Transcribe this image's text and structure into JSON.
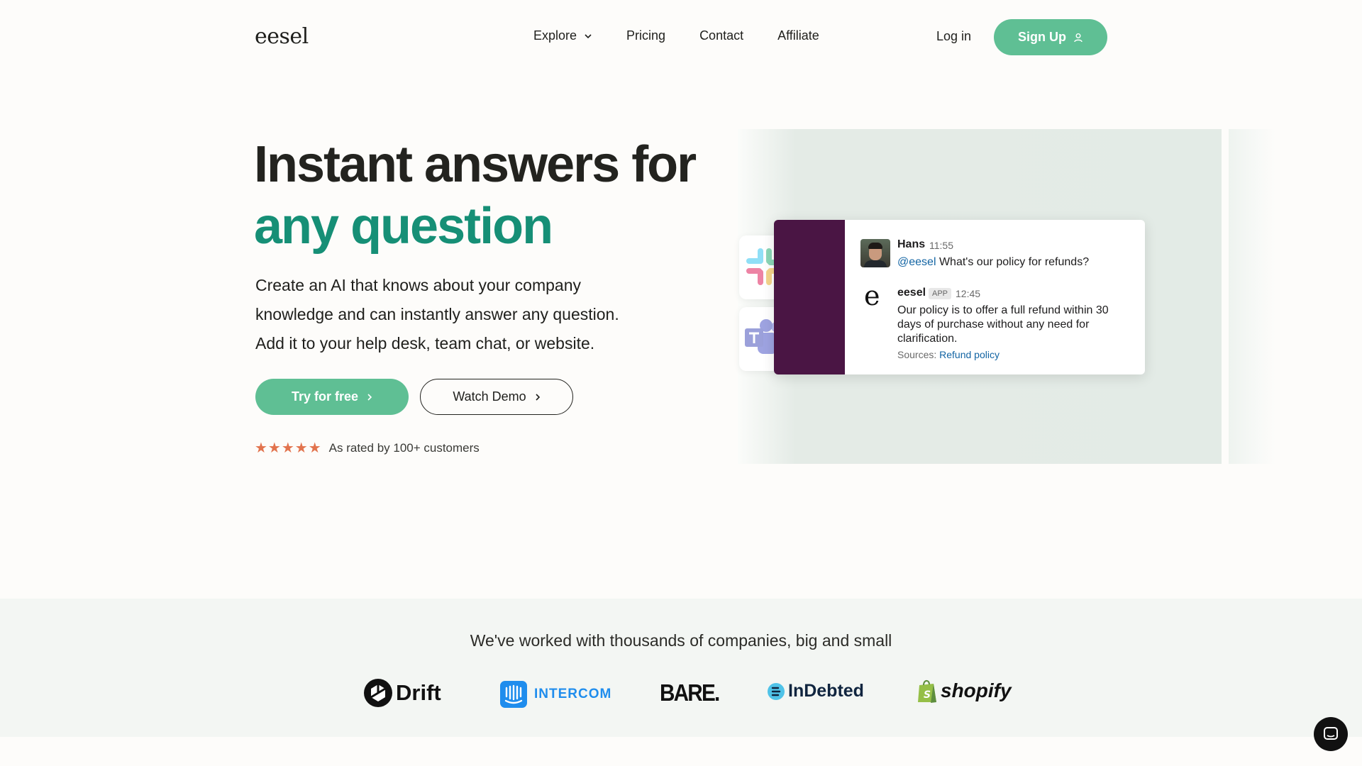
{
  "nav": {
    "logo": "eesel",
    "links": [
      "Explore",
      "Pricing",
      "Contact",
      "Affiliate"
    ],
    "login": "Log in",
    "signup": "Sign Up"
  },
  "hero": {
    "headline_line1": "Instant answers for",
    "headline_line2": "any question",
    "subtitle_lines": [
      "Create an AI that knows about your company",
      "knowledge and can instantly answer any question.",
      "Add it to your help desk, team chat, or website."
    ],
    "try_button": "Try for free",
    "demo_button": "Watch Demo",
    "stars": "★★★★★",
    "rating_text": "As rated by 100+ customers"
  },
  "chat": {
    "msg1": {
      "name": "Hans",
      "time": "11:55",
      "mention": "@eesel",
      "text": " What's our policy for refunds?"
    },
    "msg2": {
      "name": "eesel",
      "badge": "APP",
      "time": "12:45",
      "lines": [
        "Our policy is to offer a full refund within 30",
        "days of purchase without any need for",
        "clarification."
      ],
      "sources_label": "Sources:",
      "sources_link": "Refund policy"
    }
  },
  "companies": {
    "title": "We've worked with thousands of companies, big and small",
    "logos": [
      "Drift",
      "INTERCOM",
      "BARE.",
      "InDebted",
      "shopify"
    ]
  },
  "colors": {
    "brand_green": "#5fbf94",
    "headline_green": "#168f76",
    "slack_purple": "#4a1544",
    "star_orange": "#e2734d"
  }
}
